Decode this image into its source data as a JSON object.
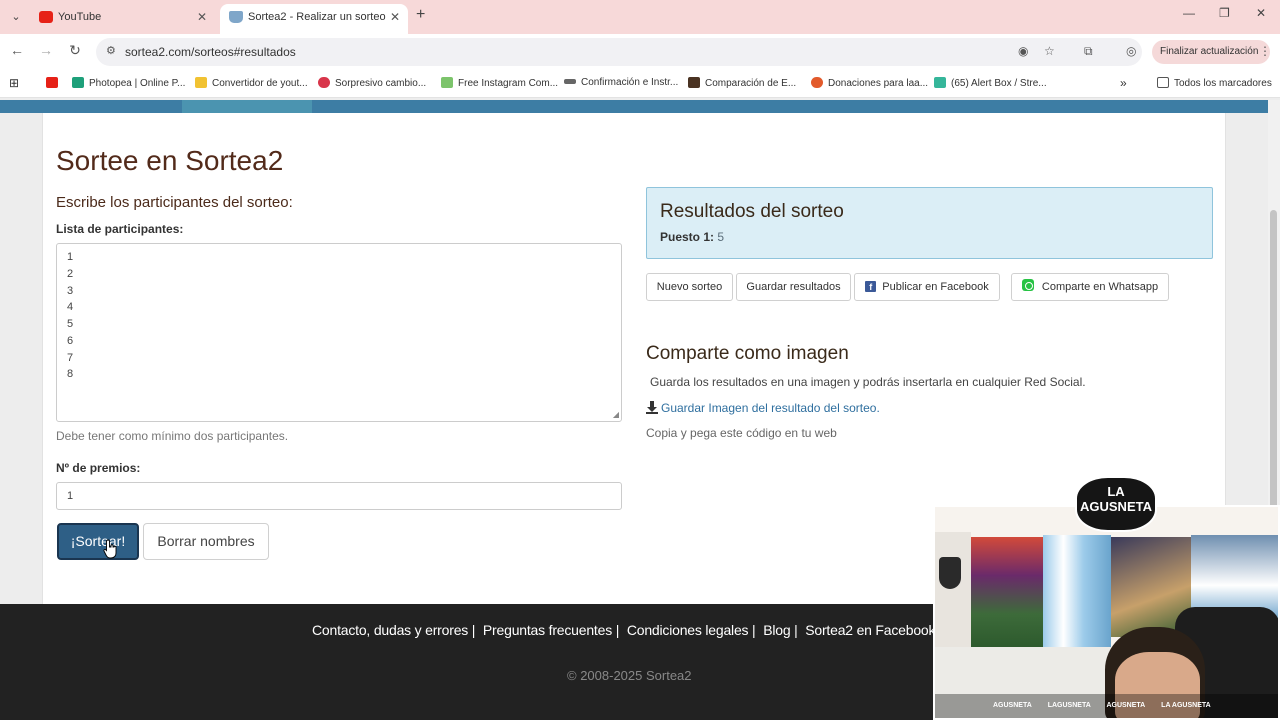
{
  "browser": {
    "tabs": [
      {
        "title": "YouTube",
        "favicon_color": "#e62117"
      },
      {
        "title": "Sortea2 - Realizar un sorteo",
        "favicon_color": "#7fa6c9"
      }
    ],
    "url": "sortea2.com/sorteos#resultados",
    "update_button": "Finalizar actualización",
    "bookmarks": [
      {
        "label": "",
        "color": "#e62117"
      },
      {
        "label": "Photopea | Online P...",
        "color": "#1ea07a"
      },
      {
        "label": "Convertidor de yout...",
        "color": "#f1c232"
      },
      {
        "label": "Sorpresivo cambio...",
        "color": "#d8354a"
      },
      {
        "label": "Free Instagram Com...",
        "color": "#7cc46b"
      },
      {
        "label": "Confirmación e Instr...",
        "color": "#666666"
      },
      {
        "label": "Comparación de E...",
        "color": "#4a3322"
      },
      {
        "label": "Donaciones para laa...",
        "color": "#e25a2b"
      },
      {
        "label": "(65) Alert Box / Stre...",
        "color": "#35b69a"
      }
    ],
    "all_bookmarks": "Todos los marcadores"
  },
  "page": {
    "title": "Sortee en Sortea2",
    "subtitle": "Escribe los participantes del sorteo:",
    "participants_label": "Lista de participantes:",
    "participants": [
      "1",
      "2",
      "3",
      "4",
      "5",
      "6",
      "7",
      "8"
    ],
    "help_text": "Debe tener como mínimo dos participantes.",
    "prizes_label": "Nº de premios:",
    "prizes_value": "1",
    "draw_button": "¡Sortear!",
    "clear_button": "Borrar nombres"
  },
  "results": {
    "title": "Resultados del sorteo",
    "place_label": "Puesto 1:",
    "place_value": "5",
    "buttons": {
      "new": "Nuevo sorteo",
      "save": "Guardar resultados",
      "facebook": "Publicar en Facebook",
      "whatsapp": "Comparte en Whatsapp"
    }
  },
  "share": {
    "title": "Comparte como imagen",
    "description": "Guarda los resultados en una imagen y podrás insertarla en cualquier Red Social.",
    "download_link": "Guardar Imagen del resultado del sorteo.",
    "copy_text": "Copia y pega este código en tu web"
  },
  "footer": {
    "links": [
      "Contacto, dudas y errores |",
      "Preguntas frecuentes |",
      "Condiciones legales |",
      "Blog |",
      "Sortea2 en Facebook |"
    ],
    "copyright": "© 2008-2025 Sortea2"
  },
  "webcam": {
    "logo_line1": "LA",
    "logo_line2": "AGUSNETA",
    "social": [
      "AGUSNETA",
      "LAGUSNETA",
      "AGUSNETA",
      "LA AGUSNETA"
    ]
  }
}
